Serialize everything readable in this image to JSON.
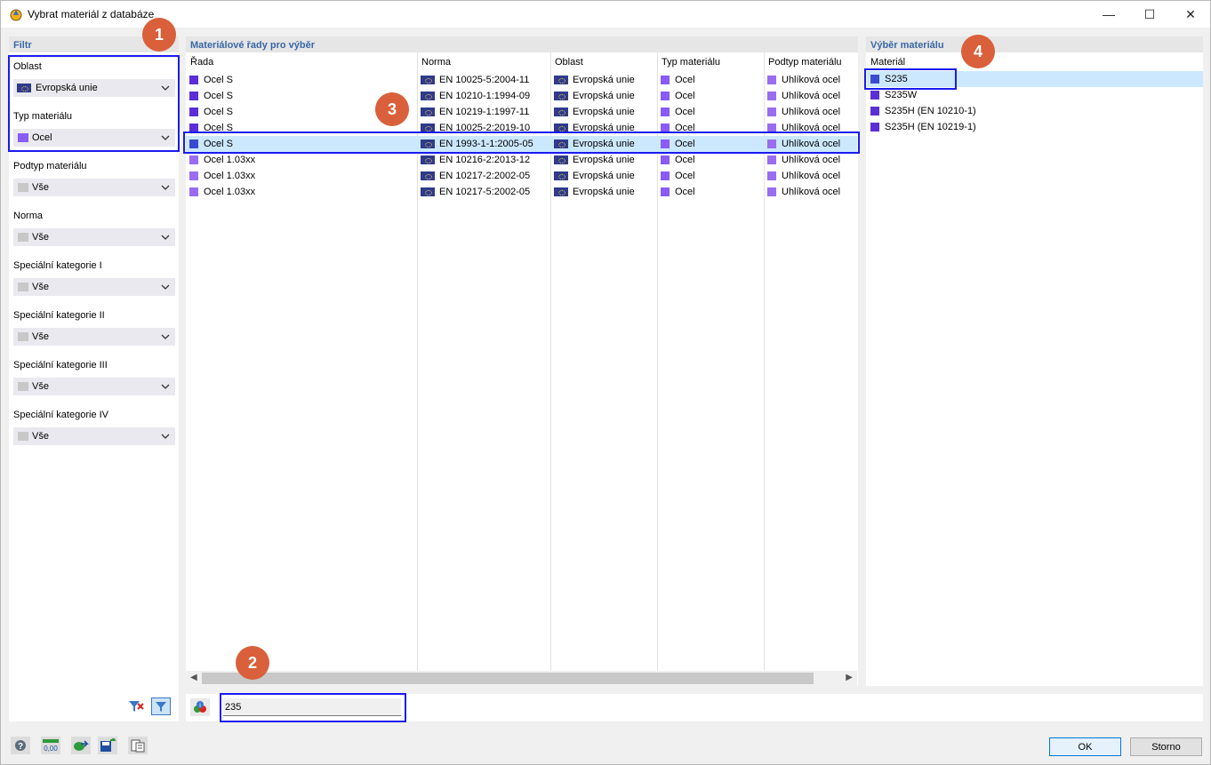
{
  "window": {
    "title": "Vybrat materiál z databáze",
    "min": "—",
    "max": "☐",
    "close": "✕"
  },
  "filter": {
    "header": "Filtr",
    "groups": [
      {
        "label": "Oblast",
        "value": "Evropská unie",
        "swatch": "eu-flag"
      },
      {
        "label": "Typ materiálu",
        "value": "Ocel",
        "swatch": "#8a5cf6"
      },
      {
        "label": "Podtyp materiálu",
        "value": "Vše",
        "swatch": "#c8c8c8"
      },
      {
        "label": "Norma",
        "value": "Vše",
        "swatch": "#c8c8c8"
      },
      {
        "label": "Speciální kategorie I",
        "value": "Vše",
        "swatch": "#c8c8c8"
      },
      {
        "label": "Speciální kategorie II",
        "value": "Vše",
        "swatch": "#c8c8c8"
      },
      {
        "label": "Speciální kategorie III",
        "value": "Vše",
        "swatch": "#c8c8c8"
      },
      {
        "label": "Speciální kategorie IV",
        "value": "Vše",
        "swatch": "#c8c8c8"
      }
    ]
  },
  "series": {
    "header": "Materiálové řady pro výběr",
    "columns": [
      "Řada",
      "Norma",
      "Oblast",
      "Typ materiálu",
      "Podtyp materiálu"
    ],
    "rows": [
      {
        "rada": "Ocel S",
        "norma": "EN 10025-5:2004-11",
        "oblast": "Evropská unie",
        "typ": "Ocel",
        "podtyp": "Uhlíková ocel",
        "color": "#5b2fd6"
      },
      {
        "rada": "Ocel S",
        "norma": "EN 10210-1:1994-09",
        "oblast": "Evropská unie",
        "typ": "Ocel",
        "podtyp": "Uhlíková ocel",
        "color": "#5b2fd6"
      },
      {
        "rada": "Ocel S",
        "norma": "EN 10219-1:1997-11",
        "oblast": "Evropská unie",
        "typ": "Ocel",
        "podtyp": "Uhlíková ocel",
        "color": "#5b2fd6"
      },
      {
        "rada": "Ocel S",
        "norma": "EN 10025-2:2019-10",
        "oblast": "Evropská unie",
        "typ": "Ocel",
        "podtyp": "Uhlíková ocel",
        "color": "#5b2fd6"
      },
      {
        "rada": "Ocel S",
        "norma": "EN 1993-1-1:2005-05",
        "oblast": "Evropská unie",
        "typ": "Ocel",
        "podtyp": "Uhlíková ocel",
        "color": "#3a4bd0"
      },
      {
        "rada": "Ocel 1.03xx",
        "norma": "EN 10216-2:2013-12",
        "oblast": "Evropská unie",
        "typ": "Ocel",
        "podtyp": "Uhlíková ocel",
        "color": "#9a6cf0"
      },
      {
        "rada": "Ocel 1.03xx",
        "norma": "EN 10217-2:2002-05",
        "oblast": "Evropská unie",
        "typ": "Ocel",
        "podtyp": "Uhlíková ocel",
        "color": "#9a6cf0"
      },
      {
        "rada": "Ocel 1.03xx",
        "norma": "EN 10217-5:2002-05",
        "oblast": "Evropská unie",
        "typ": "Ocel",
        "podtyp": "Uhlíková ocel",
        "color": "#9a6cf0"
      }
    ],
    "selected_index": 4
  },
  "materials": {
    "header": "Výběr materiálu",
    "column": "Materiál",
    "items": [
      {
        "name": "S235",
        "color": "#3a4bd0"
      },
      {
        "name": "S235W",
        "color": "#5b2fd6"
      },
      {
        "name": "S235H (EN 10210-1)",
        "color": "#5b2fd6"
      },
      {
        "name": "S235H (EN 10219-1)",
        "color": "#5b2fd6"
      }
    ],
    "selected_index": 0
  },
  "search": {
    "value": "235"
  },
  "badges": [
    "1",
    "2",
    "3",
    "4"
  ],
  "buttons": {
    "ok": "OK",
    "cancel": "Storno"
  },
  "colors": {
    "accent": "#0078d7",
    "highlight": "#1a1aef",
    "badge": "#d9603b",
    "selection": "#cce8ff",
    "header_text": "#3a67a6"
  }
}
